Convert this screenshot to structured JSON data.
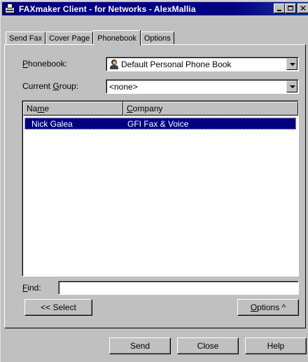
{
  "window": {
    "title": "FAXmaker Client - for Networks - AlexMallia"
  },
  "tabs": [
    {
      "label": "Send Fax"
    },
    {
      "label": "Cover Page"
    },
    {
      "label": "Phonebook",
      "active": true
    },
    {
      "label": "Options"
    }
  ],
  "phonebook": {
    "label_prefix": "P",
    "label_rest": "honebook:",
    "value": "Default Personal Phone Book"
  },
  "group": {
    "label_prefix": "Current ",
    "label_u": "G",
    "label_rest": "roup:",
    "value": "<none>"
  },
  "list": {
    "columns": {
      "name_pre": "Na",
      "name_u": "m",
      "name_post": "e",
      "company_u": "C",
      "company_post": "ompany"
    },
    "rows": [
      {
        "name": "Nick Galea",
        "company": "GFI Fax & Voice",
        "selected": true
      }
    ]
  },
  "find": {
    "label_u": "F",
    "label_rest": "ind:",
    "value": ""
  },
  "buttons": {
    "select": "<< Select",
    "options_u": "O",
    "options_rest": "ptions ^",
    "send": "Send",
    "close": "Close",
    "help": "Help"
  },
  "icons": {
    "app": "fax-machine-icon",
    "phonebook": "person-icon"
  }
}
